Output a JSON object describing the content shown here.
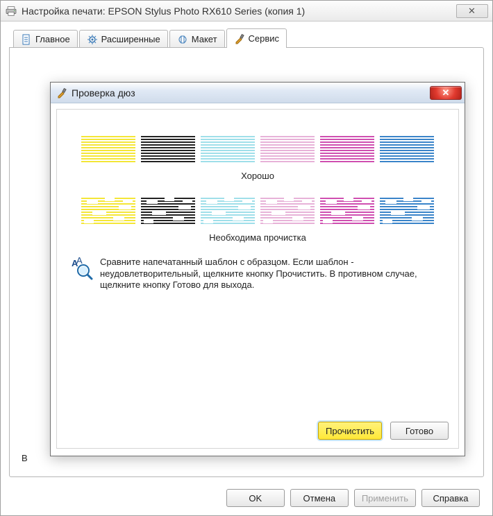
{
  "outer": {
    "title": "Настройка печати: EPSON Stylus Photo RX610 Series (копия 1)",
    "close_glyph": "✕"
  },
  "tabs": {
    "items": [
      {
        "label": "Главное",
        "icon": "document-icon"
      },
      {
        "label": "Расширенные",
        "icon": "gear-icon"
      },
      {
        "label": "Макет",
        "icon": "layout-icon"
      },
      {
        "label": "Сервис",
        "icon": "tools-icon"
      }
    ],
    "active_index": 3
  },
  "peek_letter": "В",
  "buttons": {
    "ok": "OK",
    "cancel": "Отмена",
    "apply": "Применить",
    "help": "Справка"
  },
  "dialog": {
    "title": "Проверка дюз",
    "close_glyph": "✕",
    "good_label": "Хорошо",
    "bad_label": "Необходима прочистка",
    "instructions": "Сравните напечатанный шаблон с образцом. Если шаблон - неудовлетворительный, щелкните кнопку Прочистить. В противном случае, щелкните кнопку Готово для выхода.",
    "clean": "Прочистить",
    "done": "Готово",
    "swatches": [
      {
        "name": "yellow",
        "color": "#f4e637"
      },
      {
        "name": "black",
        "color": "#222222"
      },
      {
        "name": "light-cyan",
        "color": "#9fdfe9"
      },
      {
        "name": "light-magenta",
        "color": "#e7b2d8"
      },
      {
        "name": "magenta",
        "color": "#cf4fb0"
      },
      {
        "name": "cyan",
        "color": "#3a84c9"
      }
    ]
  }
}
